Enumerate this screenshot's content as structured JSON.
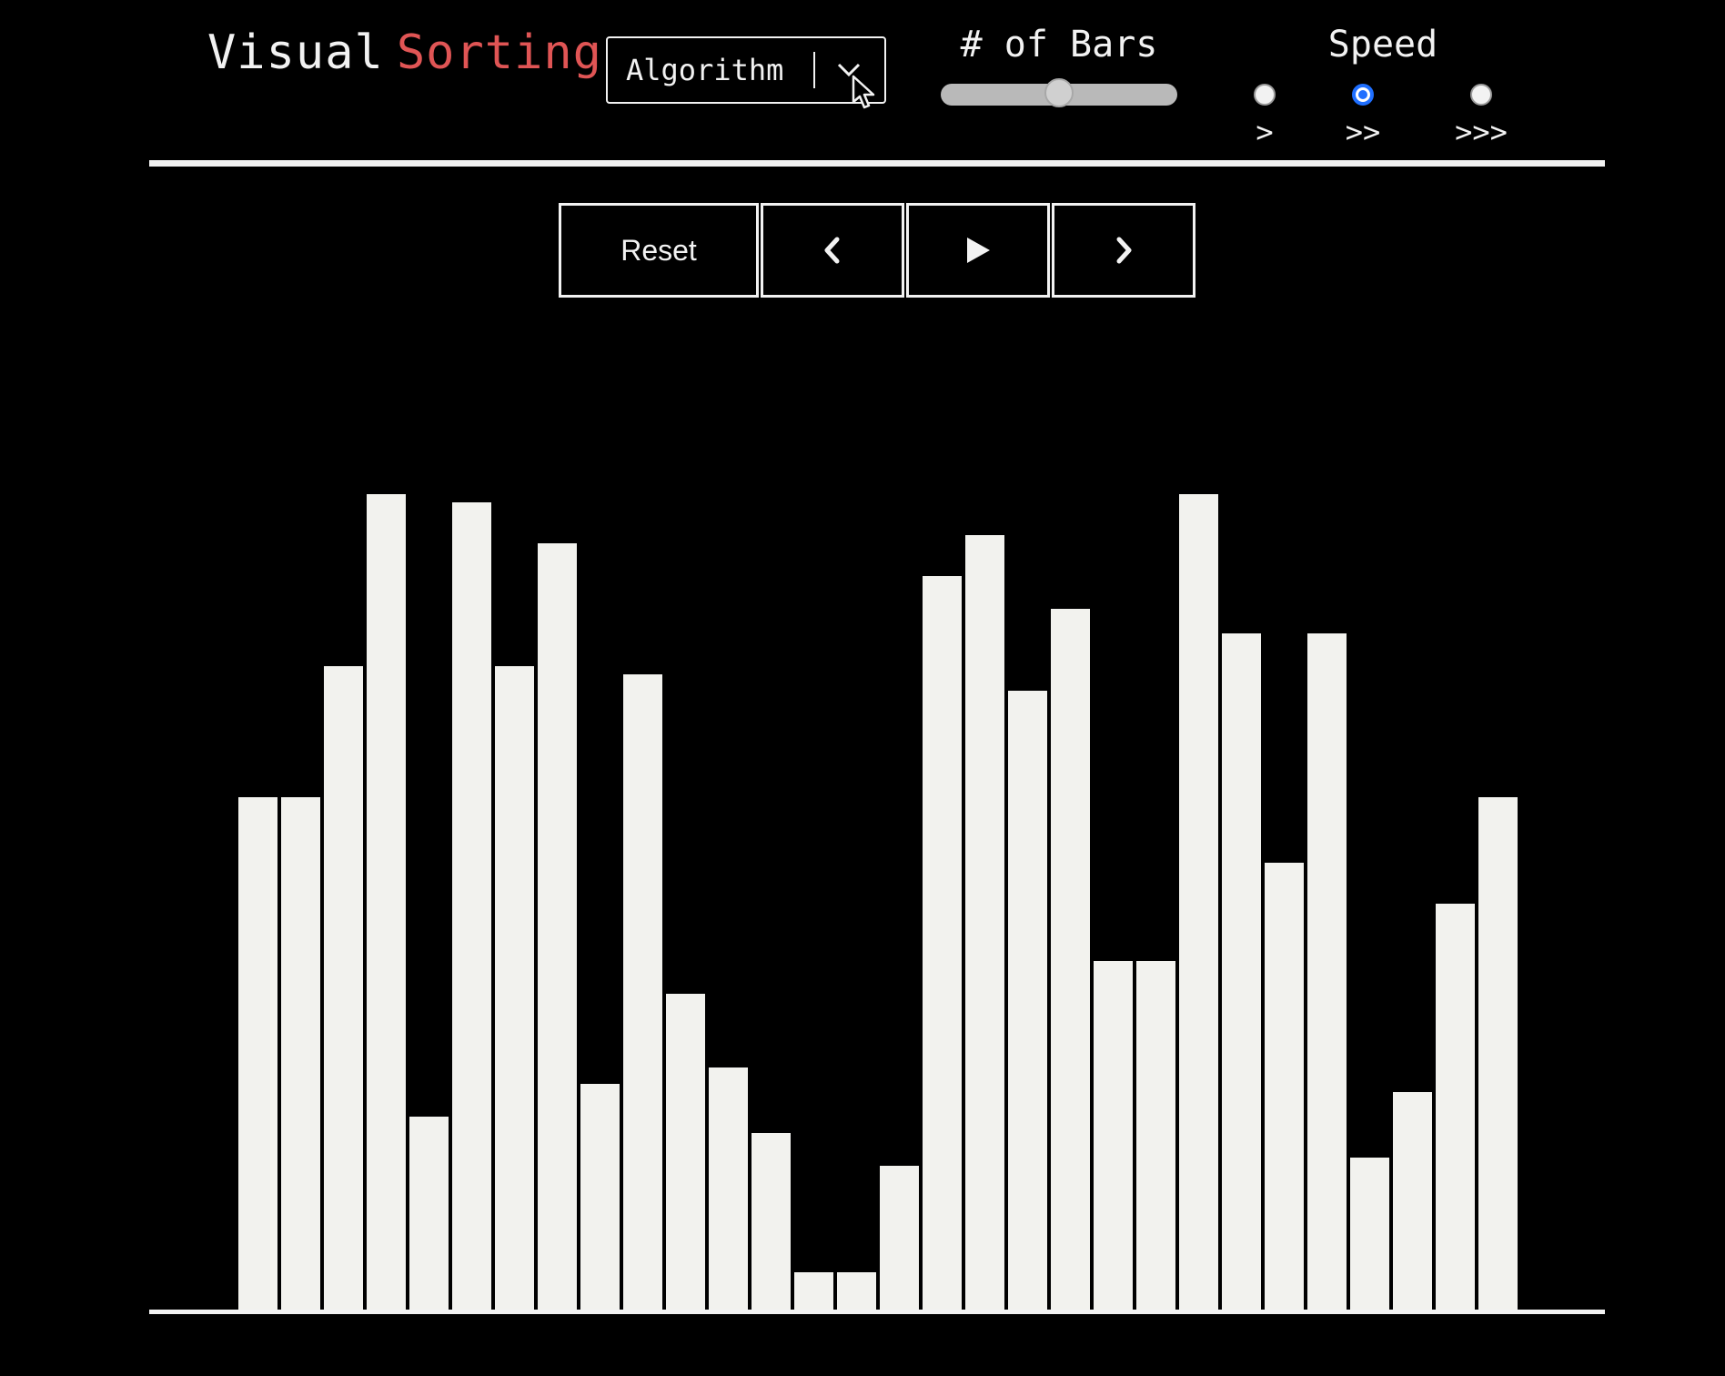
{
  "header": {
    "title_part1": "Visual",
    "title_part2": "Sorting",
    "title_accent_color": "#e05555",
    "algorithm_select": {
      "label": "Algorithm",
      "icon": "chevron-down-icon"
    },
    "bars_control": {
      "label": "# of Bars",
      "value": 30,
      "min": 10,
      "max": 50
    },
    "speed": {
      "label": "Speed",
      "options": [
        {
          "label": ">",
          "selected": false
        },
        {
          "label": ">>",
          "selected": true
        },
        {
          "label": ">>>",
          "selected": false
        }
      ],
      "selected_color": "#1f6fff"
    }
  },
  "controls": {
    "reset_label": "Reset",
    "prev_icon": "chevron-left-icon",
    "play_icon": "play-icon",
    "next_icon": "chevron-right-icon"
  },
  "chart_data": {
    "type": "bar",
    "values": [
      63,
      63,
      79,
      100,
      24,
      99,
      79,
      94,
      28,
      78,
      39,
      30,
      22,
      5,
      5,
      18,
      90,
      95,
      76,
      86,
      43,
      43,
      100,
      83,
      55,
      83,
      19,
      27,
      50,
      63
    ],
    "bar_color": "#f2f2ee",
    "ylim": [
      0,
      100
    ]
  }
}
